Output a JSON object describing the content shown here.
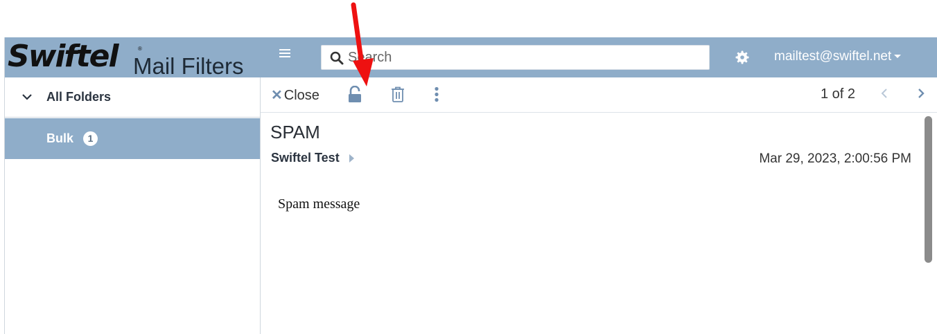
{
  "header": {
    "logo_brand": "Swiftel",
    "logo_mark": "®",
    "logo_sub": "Mail Filters",
    "search_placeholder": "Search",
    "account": "mailtest@swiftel.net"
  },
  "sidebar": {
    "all_folders": "All Folders",
    "folders": [
      {
        "label": "Bulk",
        "count": "1"
      }
    ]
  },
  "toolbar": {
    "close": "Close",
    "pager": "1 of 2"
  },
  "message": {
    "subject": "SPAM",
    "sender": "Swiftel Test",
    "date": "Mar 29, 2023, 2:00:56 PM",
    "body": "Spam message"
  },
  "colors": {
    "header_bg": "#8fadc9",
    "selected_folder_bg": "#8fadc9",
    "accent_icon": "#6f8eb0",
    "annotation_arrow": "#ee1111"
  },
  "icons": [
    "menu-icon",
    "search-icon",
    "gear-icon",
    "chevron-down-icon",
    "close-icon",
    "unlock-icon",
    "trash-icon",
    "more-vertical-icon",
    "chevron-left-icon",
    "chevron-right-icon",
    "caret-right-icon"
  ]
}
